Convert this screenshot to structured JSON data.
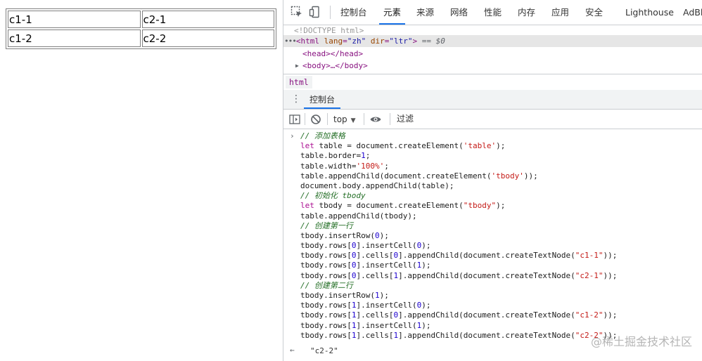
{
  "page": {
    "table": {
      "rows": [
        [
          "c1-1",
          "c2-1"
        ],
        [
          "c1-2",
          "c2-2"
        ]
      ]
    }
  },
  "devtools": {
    "tabs": [
      "控制台",
      "元素",
      "来源",
      "网络",
      "性能",
      "内存",
      "应用",
      "安全",
      "Lighthouse",
      "AdBlock"
    ],
    "active_tab": "元素",
    "elements": {
      "doctype": "<!DOCTYPE html>",
      "html_open": "<html",
      "lang_attr": "lang",
      "lang_val": "\"zh\"",
      "dir_attr": "dir",
      "dir_val": "\"ltr\"",
      "html_close": ">",
      "selected_marker": "== $0",
      "head": "<head></head>",
      "body": "<body>…</body>"
    },
    "breadcrumb": "html",
    "drawer_tab": "控制台",
    "console_toolbar": {
      "context": "top",
      "filter_placeholder": "过滤"
    },
    "console_code": [
      "// 添加表格",
      "let table = document.createElement('table');",
      "table.border=1;",
      "table.width='100%';",
      "table.appendChild(document.createElement('tbody'));",
      "document.body.appendChild(table);",
      "// 初始化 tbody",
      "let tbody = document.createElement(\"tbody\");",
      "table.appendChild(tbody);",
      "// 创建第一行",
      "tbody.insertRow(0);",
      "tbody.rows[0].insertCell(0);",
      "tbody.rows[0].cells[0].appendChild(document.createTextNode(\"c1-1\"));",
      "tbody.rows[0].insertCell(1);",
      "tbody.rows[0].cells[1].appendChild(document.createTextNode(\"c2-1\"));",
      "// 创建第二行",
      "tbody.insertRow(1);",
      "tbody.rows[1].insertCell(0);",
      "tbody.rows[1].cells[0].appendChild(document.createTextNode(\"c1-2\"));",
      "tbody.rows[1].insertCell(1);",
      "tbody.rows[1].cells[1].appendChild(document.createTextNode(\"c2-2\"));"
    ],
    "console_result": "\"c2-2\"",
    "watermark": "@稀土掘金技术社区"
  },
  "colors": {
    "accent": "#1a73e8",
    "tag": "#881280",
    "attr": "#994500",
    "value": "#1a1aa6"
  }
}
